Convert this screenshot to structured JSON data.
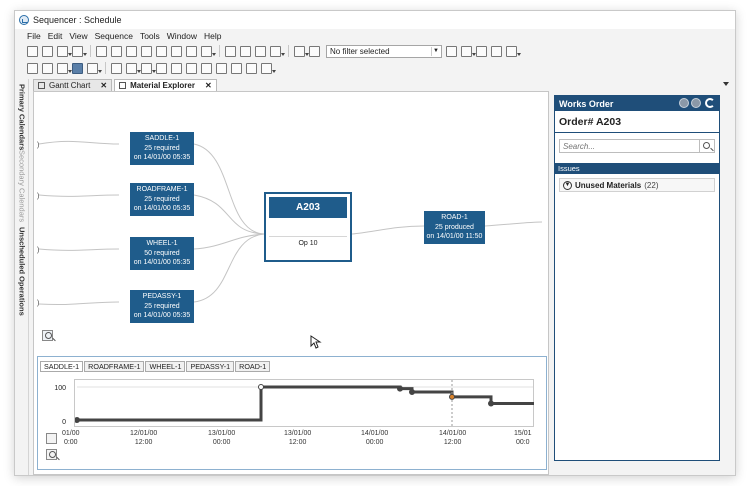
{
  "window": {
    "title": "Sequencer : Schedule"
  },
  "menu": [
    "File",
    "Edit",
    "View",
    "Sequence",
    "Tools",
    "Window",
    "Help"
  ],
  "toolbar": {
    "filter_value": "No filter selected"
  },
  "left_rail": [
    "Primary Calendars",
    "Secondary Calendars",
    "Unscheduled Operations"
  ],
  "tabs": [
    {
      "label": "Gantt Chart",
      "close": "✕"
    },
    {
      "label": "Material Explorer",
      "close": "✕"
    }
  ],
  "materials": [
    {
      "name": "SADDLE-1",
      "qty": "25 required",
      "date": "on 14/01/00 05:35"
    },
    {
      "name": "ROADFRAME-1",
      "qty": "25 required",
      "date": "on 14/01/00 05:35"
    },
    {
      "name": "WHEEL-1",
      "qty": "50 required",
      "date": "on 14/01/00 05:35"
    },
    {
      "name": "PEDASSY-1",
      "qty": "25 required",
      "date": "on 14/01/00 05:35"
    }
  ],
  "order_node": {
    "name": "A203",
    "op": "Op 10"
  },
  "output": {
    "name": "ROAD-1",
    "qty": "25 produced",
    "date": "on 14/01/00 11:50"
  },
  "colors": {
    "accent": "#1f4e79",
    "node_fill": "#1f5c8b",
    "line": "#444444",
    "marker": "#d9822b"
  },
  "chart_tabs": [
    "SADDLE-1",
    "ROADFRAME-1",
    "WHEEL-1",
    "PEDASSY-1",
    "ROAD-1"
  ],
  "chart_data": {
    "type": "line",
    "series": [
      {
        "values": [
          0,
          100,
          95,
          85,
          70,
          50
        ]
      }
    ],
    "x": [
      "01/00 00:00",
      "13/01/00 00:00",
      "14/01/00 05:35",
      "14/01/00 06:00",
      "14/01/00 11:50",
      "14/01/00 18:00"
    ],
    "y_ticks": [
      "0",
      "100"
    ],
    "x_ticks": [
      {
        "date": "01/00",
        "time": "0:00"
      },
      {
        "date": "12/01/00",
        "time": "12:00"
      },
      {
        "date": "13/01/00",
        "time": "00:00"
      },
      {
        "date": "13/01/00",
        "time": "12:00"
      },
      {
        "date": "14/01/00",
        "time": "00:00"
      },
      {
        "date": "14/01/00",
        "time": "12:00"
      },
      {
        "date": "15/01",
        "time": "00:0"
      }
    ],
    "ylim": [
      0,
      100
    ]
  },
  "right_panel": {
    "header": "Works Order",
    "order_label": "Order# A203",
    "search_placeholder": "Search...",
    "issues_label": "Issues",
    "issue_name": "Unused Materials",
    "issue_count": "(22)"
  }
}
